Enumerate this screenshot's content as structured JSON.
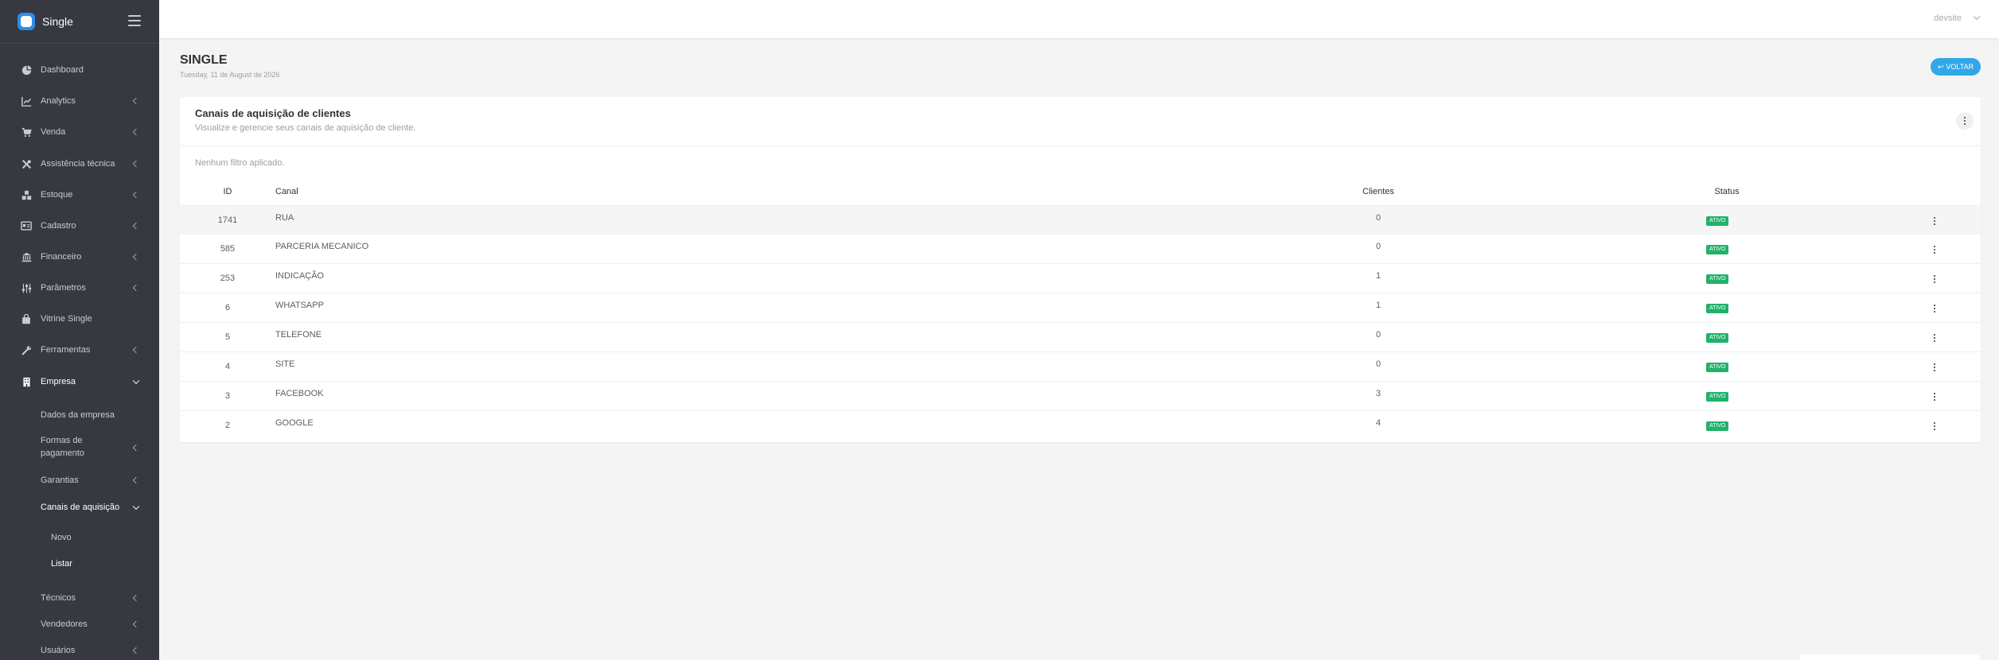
{
  "brand": {
    "name": "Single"
  },
  "sidebar": {
    "items": [
      {
        "label": "Dashboard",
        "icon": "pie-chart-icon"
      },
      {
        "label": "Analytics",
        "icon": "line-chart-icon"
      },
      {
        "label": "Venda",
        "icon": "cart-icon"
      },
      {
        "label": "Assistência técnica",
        "icon": "tools-icon"
      },
      {
        "label": "Estoque",
        "icon": "boxes-icon"
      },
      {
        "label": "Cadastro",
        "icon": "id-card-icon"
      },
      {
        "label": "Financeiro",
        "icon": "bank-icon"
      },
      {
        "label": "Parâmetros",
        "icon": "sliders-icon"
      },
      {
        "label": "Vitrine Single",
        "icon": "shopping-bag-icon"
      },
      {
        "label": "Ferramentas",
        "icon": "wrench-icon"
      },
      {
        "label": "Empresa",
        "icon": "building-icon"
      }
    ],
    "empresa_sub": [
      {
        "label": "Dados da empresa"
      },
      {
        "label": "Formas de pagamento"
      },
      {
        "label": "Garantias"
      },
      {
        "label": "Canais de aquisição"
      }
    ],
    "canais_sub": [
      {
        "label": "Novo"
      },
      {
        "label": "Listar"
      }
    ],
    "empresa_sub_after": [
      {
        "label": "Técnicos"
      },
      {
        "label": "Vendedores"
      },
      {
        "label": "Usuários"
      }
    ]
  },
  "topbar": {
    "user": "devsite"
  },
  "page": {
    "title": "SINGLE",
    "date": "Tuesday, 11 de August de 2026",
    "back_label": "VOLTAR"
  },
  "card": {
    "title": "Canais de aquisição de clientes",
    "subtitle": "Visualize e gerencie seus canais de aquisição de cliente.",
    "filter_text": "Nenhum filtro aplicado."
  },
  "table": {
    "headers": {
      "id": "ID",
      "canal": "Canal",
      "clientes": "Clientes",
      "status": "Status"
    },
    "rows": [
      {
        "id": "1741",
        "canal": "RUA",
        "clientes": "0",
        "status": "ATIVO"
      },
      {
        "id": "585",
        "canal": "PARCERIA MECANICO",
        "clientes": "0",
        "status": "ATIVO"
      },
      {
        "id": "253",
        "canal": "INDICAÇÃO",
        "clientes": "1",
        "status": "ATIVO"
      },
      {
        "id": "6",
        "canal": "WHATSAPP",
        "clientes": "1",
        "status": "ATIVO"
      },
      {
        "id": "5",
        "canal": "TELEFONE",
        "clientes": "0",
        "status": "ATIVO"
      },
      {
        "id": "4",
        "canal": "SITE",
        "clientes": "0",
        "status": "ATIVO"
      },
      {
        "id": "3",
        "canal": "FACEBOOK",
        "clientes": "3",
        "status": "ATIVO"
      },
      {
        "id": "2",
        "canal": "GOOGLE",
        "clientes": "4",
        "status": "ATIVO"
      }
    ]
  },
  "colors": {
    "sidebar_bg": "#363a40",
    "accent": "#30a7e8",
    "status_active": "#1fb26b"
  }
}
